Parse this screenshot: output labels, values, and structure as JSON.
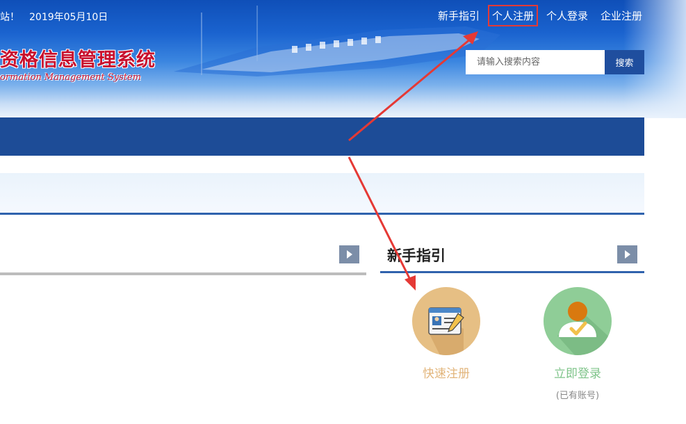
{
  "header": {
    "greeting": "站！",
    "date": "2019年05月10日",
    "system_title": "资格信息管理系统",
    "system_subtitle": "ormation Management System",
    "top_links": [
      "新手指引",
      "个人注册",
      "个人登录",
      "企业注册"
    ],
    "highlighted_link_index": 1
  },
  "search": {
    "placeholder": "请输入搜索内容",
    "button_label": "搜索"
  },
  "guide": {
    "title": "新手指引",
    "register_label": "快速注册",
    "login_label": "立即登录",
    "login_sublabel": "(已有账号)"
  },
  "colors": {
    "nav": "#1d4c97",
    "title_red": "#c8102e",
    "register_circle": "#e6bf84",
    "login_circle": "#8fcd97",
    "register_text": "#e2b57b",
    "login_text": "#7fc48a",
    "annotation": "#e53935"
  }
}
